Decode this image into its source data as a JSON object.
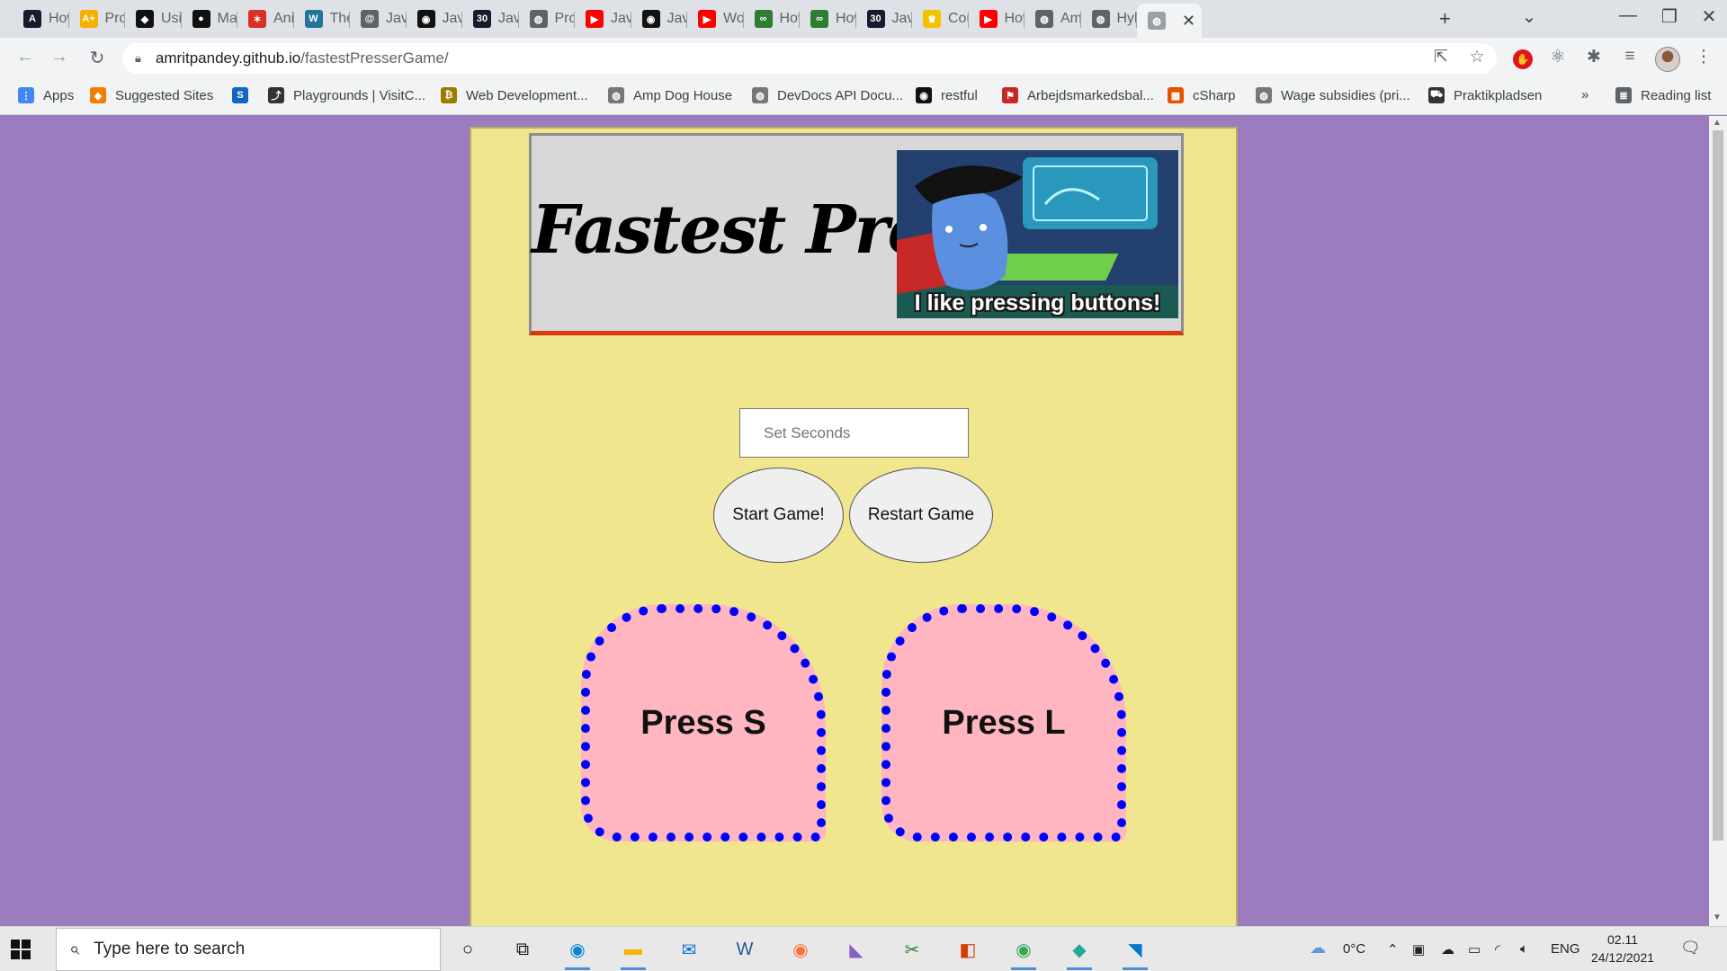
{
  "browser": {
    "tabs": [
      {
        "icon": "code-icon",
        "color": "#1a1a2e",
        "glyph": "A",
        "label": "How"
      },
      {
        "icon": "aplus-icon",
        "color": "#f5b100",
        "glyph": "A+",
        "label": "Pro"
      },
      {
        "icon": "message-icon",
        "color": "#111111",
        "glyph": "◆",
        "label": "Usi"
      },
      {
        "icon": "medium-icon",
        "color": "#111111",
        "glyph": "●",
        "label": "Ma"
      },
      {
        "icon": "figure-icon",
        "color": "#d93025",
        "glyph": "✶",
        "label": "Ani"
      },
      {
        "icon": "wordpress-icon",
        "color": "#21759b",
        "glyph": "W",
        "label": "The"
      },
      {
        "icon": "spiral-icon",
        "color": "#5f6368",
        "glyph": "@",
        "label": "Java"
      },
      {
        "icon": "github-icon",
        "color": "#111111",
        "glyph": "◉",
        "label": "Java"
      },
      {
        "icon": "thirty-icon",
        "color": "#1a1a2e",
        "glyph": "30",
        "label": "Java"
      },
      {
        "icon": "globe-icon",
        "color": "#5f6368",
        "glyph": "◍",
        "label": "Pro"
      },
      {
        "icon": "youtube-icon",
        "color": "#ff0000",
        "glyph": "▶",
        "label": "Java"
      },
      {
        "icon": "github-icon",
        "color": "#111111",
        "glyph": "◉",
        "label": "Java"
      },
      {
        "icon": "youtube-icon",
        "color": "#ff0000",
        "glyph": "▶",
        "label": "Wo"
      },
      {
        "icon": "infinity-icon",
        "color": "#2e7d32",
        "glyph": "∞",
        "label": "How"
      },
      {
        "icon": "infinity-icon",
        "color": "#2e7d32",
        "glyph": "∞",
        "label": "How"
      },
      {
        "icon": "thirty-icon",
        "color": "#1a1a2e",
        "glyph": "30",
        "label": "Java"
      },
      {
        "icon": "crown-icon",
        "color": "#f2c200",
        "glyph": "♛",
        "label": "Cou"
      },
      {
        "icon": "youtube-icon",
        "color": "#ff0000",
        "glyph": "▶",
        "label": "How"
      },
      {
        "icon": "globe-icon",
        "color": "#5f6368",
        "glyph": "◍",
        "label": "Am"
      },
      {
        "icon": "globe-icon",
        "color": "#5f6368",
        "glyph": "◍",
        "label": "Hyl"
      }
    ],
    "active_tab_icon": "globe-icon",
    "new_tab": "+",
    "url_host": "amritpandey.github.io",
    "url_path": "/fastestPresserGame/",
    "bookmarks": [
      {
        "icon": "apps-icon",
        "label": "Apps",
        "color": "#4285f4",
        "glyph": "⋮"
      },
      {
        "icon": "suggested-icon",
        "label": "Suggested Sites",
        "color": "#f57c00",
        "glyph": "◆"
      },
      {
        "icon": "s-icon",
        "label": "",
        "color": "#1565c0",
        "glyph": "S"
      },
      {
        "icon": "runner-icon",
        "label": "Playgrounds | VisitC...",
        "color": "#333333",
        "glyph": "⤴"
      },
      {
        "icon": "coin-icon",
        "label": "Web Development...",
        "color": "#9e7b00",
        "glyph": "₿"
      },
      {
        "icon": "globe-icon",
        "label": "Amp Dog House",
        "color": "#777777",
        "glyph": "◍"
      },
      {
        "icon": "globe-icon",
        "label": "DevDocs API Docu...",
        "color": "#777777",
        "glyph": "◍"
      },
      {
        "icon": "github-icon",
        "label": "restful",
        "color": "#111111",
        "glyph": "◉"
      },
      {
        "icon": "flag-icon",
        "label": "Arbejdsmarkedsbal...",
        "color": "#c62828",
        "glyph": "⚑"
      },
      {
        "icon": "windows-icon",
        "label": "cSharp",
        "color": "#e65100",
        "glyph": "▦"
      },
      {
        "icon": "globe-icon",
        "label": "Wage subsidies (pri...",
        "color": "#777777",
        "glyph": "◍"
      },
      {
        "icon": "pram-icon",
        "label": "Praktikpladsen",
        "color": "#333333",
        "glyph": "⛟"
      }
    ],
    "bookmarks_overflow": "»",
    "reading_list": "Reading list"
  },
  "page": {
    "title": "Fastest Presser",
    "meme_caption": "I like pressing buttons!",
    "seconds_placeholder": "Set Seconds",
    "start_label": "Start Game!",
    "restart_label": "Restart Game",
    "pad_s_label": "Press S",
    "pad_l_label": "Press L",
    "colors": {
      "background": "#9b7cbf",
      "container": "#efe68d",
      "pad_fill": "#ffb6c1",
      "pad_border": "#0000ff",
      "header_underline": "#d63a0e"
    }
  },
  "taskbar": {
    "search_placeholder": "Type here to search",
    "weather": "0°C",
    "language": "ENG",
    "time": "02.11",
    "date": "24/12/2021",
    "apps": [
      {
        "icon": "cortana-icon",
        "glyph": "○",
        "color": "#111111"
      },
      {
        "icon": "task-view-icon",
        "glyph": "⧉",
        "color": "#111111"
      },
      {
        "icon": "edge-icon",
        "glyph": "◉",
        "color": "#0a84d0"
      },
      {
        "icon": "file-explorer-icon",
        "glyph": "▬",
        "color": "#f4b400"
      },
      {
        "icon": "mail-icon",
        "glyph": "✉",
        "color": "#0a6ed1"
      },
      {
        "icon": "word-icon",
        "glyph": "W",
        "color": "#2b579a"
      },
      {
        "icon": "firefox-icon",
        "glyph": "◉",
        "color": "#ff7139"
      },
      {
        "icon": "visual-studio-icon",
        "glyph": "◣",
        "color": "#8661c5"
      },
      {
        "icon": "snip-icon",
        "glyph": "✂",
        "color": "#2e7d32"
      },
      {
        "icon": "office-icon",
        "glyph": "◧",
        "color": "#d83b01"
      },
      {
        "icon": "chrome-icon",
        "glyph": "◉",
        "color": "#34a853"
      },
      {
        "icon": "gitkraken-icon",
        "glyph": "◆",
        "color": "#26a69a"
      },
      {
        "icon": "vscode-icon",
        "glyph": "◥",
        "color": "#007acc"
      }
    ]
  }
}
